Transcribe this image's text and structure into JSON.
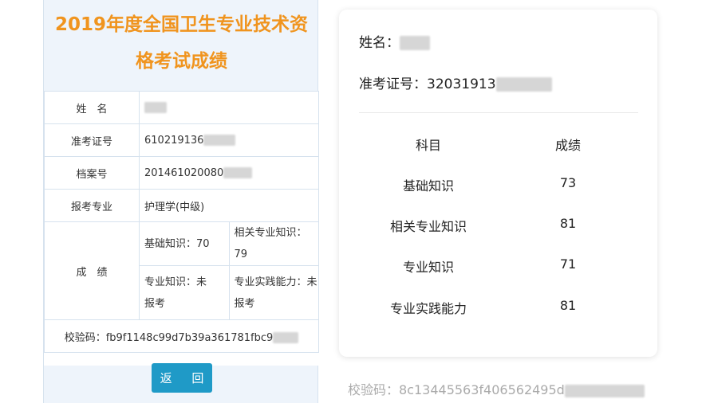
{
  "left": {
    "title_line1": "2019年度全国卫生专业技术资",
    "title_line2": "格考试成绩",
    "name_label": "姓　名",
    "id_label": "准考证号",
    "id_value": "610219136",
    "file_label": "档案号",
    "file_value": "201461020080",
    "major_label": "报考专业",
    "major_value": "护理学(中级)",
    "score_label": "成　绩",
    "scores": {
      "basic": "基础知识：70",
      "related": "相关专业知识：79",
      "professional_l1": "专业知识：未",
      "professional_l2": "报考",
      "practice_l1": "专业实践能力：未",
      "practice_l2": "报考"
    },
    "verify": "校验码：fb9f1148c99d7b39a361781fbc9",
    "back_button": "返 回"
  },
  "right": {
    "name_label": "姓名：",
    "id_label": "准考证号：",
    "id_value": "32031913",
    "col_subject": "科目",
    "col_score": "成绩",
    "rows": [
      {
        "subject": "基础知识",
        "score": "73"
      },
      {
        "subject": "相关专业知识",
        "score": "81"
      },
      {
        "subject": "专业知识",
        "score": "71"
      },
      {
        "subject": "专业实践能力",
        "score": "81"
      }
    ],
    "verify": "校验码：8c13445563f406562495d"
  },
  "colors": {
    "title_orange": "#f0941e",
    "button_blue": "#1f9ac7",
    "panel_bg": "#eef4fb",
    "border": "#d6e2ee"
  }
}
